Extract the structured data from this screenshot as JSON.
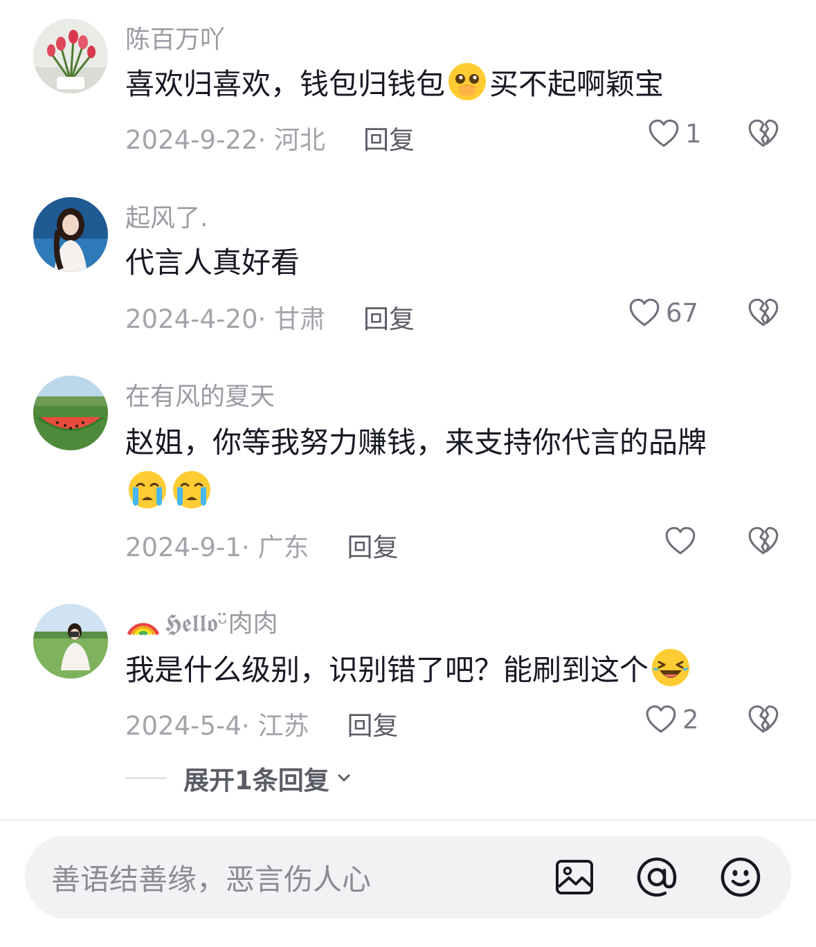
{
  "comments": [
    {
      "username": "陈百万吖",
      "text_before_emoji": "喜欢归喜欢，钱包归钱包",
      "emoji": "pleading-crying-emoji",
      "text_after_emoji": "买不起啊颖宝",
      "date_location": "2024-9-22· 河北",
      "reply_label": "回复",
      "like_count": "1"
    },
    {
      "username": "起风了.",
      "text": "代言人真好看",
      "date_location": "2024-4-20· 甘肃",
      "reply_label": "回复",
      "like_count": "67"
    },
    {
      "username": "在有风的夏天",
      "text": "赵姐，你等我努力赚钱，来支持你代言的品牌",
      "emojis": [
        "loudly-crying-emoji",
        "loudly-crying-emoji"
      ],
      "date_location": "2024-9-1· 广东",
      "reply_label": "回复",
      "like_count": ""
    },
    {
      "username_prefix_emoji": "rainbow-emoji",
      "username": "𝕳𝖊𝖑𝖑𝖔ᵕ̈肉肉",
      "text": "我是什么级别，识别错了吧？能刷到这个",
      "emoji": "laughing-tears-emoji",
      "date_location": "2024-5-4· 江苏",
      "reply_label": "回复",
      "like_count": "2"
    }
  ],
  "expand_replies_label": "展开1条回复",
  "input": {
    "placeholder": "善语结善缘，恶言伤人心",
    "icons": [
      "image-icon",
      "at-icon",
      "emoji-face-icon"
    ]
  },
  "colors": {
    "text_primary": "#161823",
    "text_secondary": "#a3a4ab",
    "reply": "#5a5c66",
    "input_bg": "#f2f2f4"
  }
}
